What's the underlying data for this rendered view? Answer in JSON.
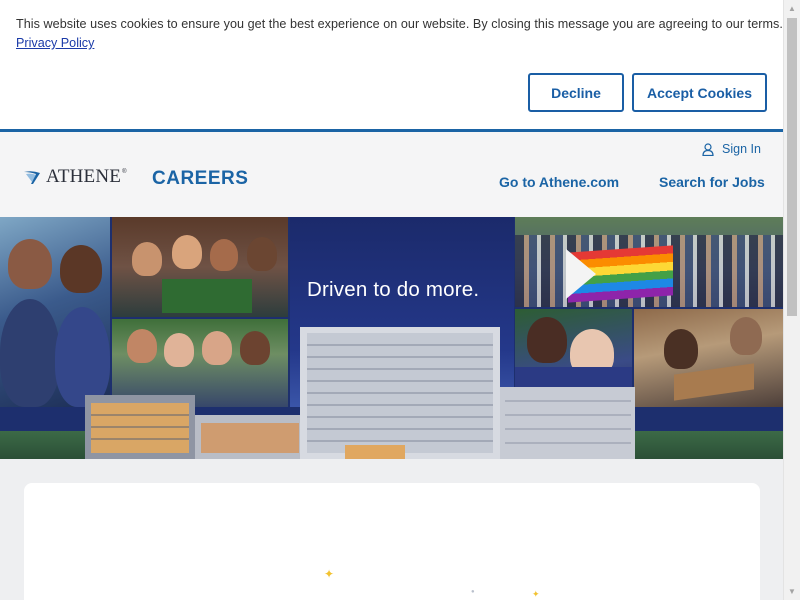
{
  "cookie_banner": {
    "message": "This website uses cookies to ensure you get the best experience on our website. By closing this message you are agreeing to our terms.",
    "privacy_link": "Privacy Policy",
    "decline_label": "Decline",
    "accept_label": "Accept Cookies"
  },
  "header": {
    "logo_text": "ATHENE",
    "logo_tm": "®",
    "section_title": "CAREERS",
    "signin_label": "Sign In",
    "signin_icon": "user-icon",
    "nav": [
      {
        "label": "Go to Athene.com"
      },
      {
        "label": "Search for Jobs"
      }
    ]
  },
  "hero": {
    "tagline": "Driven to do more."
  },
  "colors": {
    "brand_blue": "#1b64a5",
    "link_blue": "#1a3aa8",
    "hero_navy": "#1d2f6e",
    "page_bg": "#eeeff1"
  }
}
